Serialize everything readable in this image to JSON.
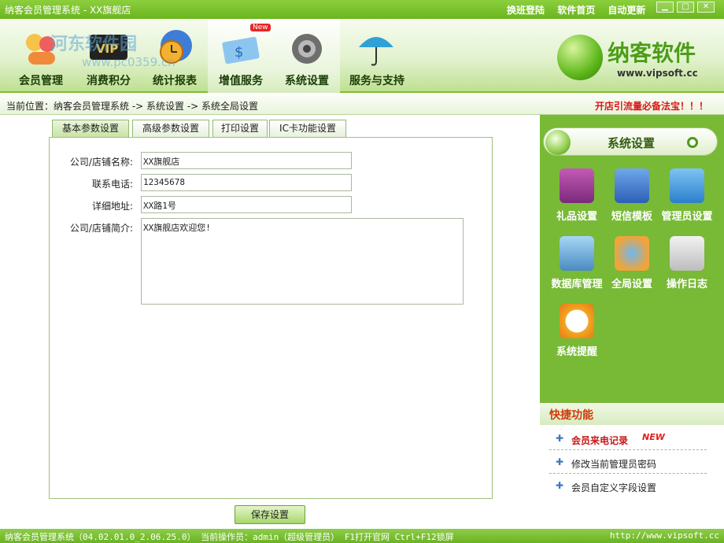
{
  "window": {
    "title": "纳客会员管理系统 - XX旗舰店"
  },
  "toplinks": [
    "换班登陆",
    "软件首页",
    "自动更新"
  ],
  "window_controls": {
    "minimize": "▁",
    "maximize": "□",
    "close": "✕"
  },
  "watermark": {
    "text": "河东软件园",
    "sub": "www.pc0359.cn"
  },
  "nav": [
    {
      "label": "会员管理",
      "icon": "members-icon"
    },
    {
      "label": "消费积分",
      "icon": "vip-card-icon"
    },
    {
      "label": "统计报表",
      "icon": "clock-report-icon"
    },
    {
      "label": "增值服务",
      "icon": "money-card-icon",
      "badge": "New"
    },
    {
      "label": "系统设置",
      "icon": "gear-icon"
    },
    {
      "label": "服务与支持",
      "icon": "umbrella-icon"
    }
  ],
  "brand": {
    "name": "纳客软件",
    "url": "www.vipsoft.cc"
  },
  "breadcrumb": {
    "text": "当前位置：纳客会员管理系统 -> 系统设置 -> 系统全局设置",
    "promo": "开店引流量必备法宝！！！"
  },
  "tabs": [
    "基本参数设置",
    "高级参数设置",
    "打印设置",
    "IC卡功能设置"
  ],
  "form": {
    "store_name_label": "公司/店铺名称:",
    "store_name_value": "XX旗舰店",
    "phone_label": "联系电话:",
    "phone_value": "12345678",
    "address_label": "详细地址:",
    "address_value": "XX路1号",
    "intro_label": "公司/店铺简介:",
    "intro_value": "XX旗舰店欢迎您!"
  },
  "save_button": "保存设置",
  "sidebar": {
    "title": "系统设置",
    "items": [
      {
        "label": "礼品设置",
        "icon": "gift-share-icon"
      },
      {
        "label": "短信模板",
        "icon": "sms-template-icon"
      },
      {
        "label": "管理员设置",
        "icon": "admin-key-icon"
      },
      {
        "label": "数据库管理",
        "icon": "database-box-icon"
      },
      {
        "label": "全局设置",
        "icon": "globe-settings-icon"
      },
      {
        "label": "操作日志",
        "icon": "log-notebook-icon"
      },
      {
        "label": "系统提醒",
        "icon": "alarm-clock-icon"
      }
    ]
  },
  "quick": {
    "title": "快捷功能",
    "items": [
      {
        "label": "会员来电记录",
        "badge": "NEW"
      },
      {
        "label": "修改当前管理员密码"
      },
      {
        "label": "会员自定义字段设置"
      }
    ]
  },
  "status": {
    "left": "纳客会员管理系统（04.02.01.0_2.06.25.0） 当前操作员：admin（超级管理员） F1打开官网 Ctrl+F12锁屏",
    "right": "http://www.vipsoft.cc"
  },
  "colors": {
    "brand_green": "#78b936",
    "accent_red": "#d81818",
    "quick_title": "#d03a08"
  }
}
